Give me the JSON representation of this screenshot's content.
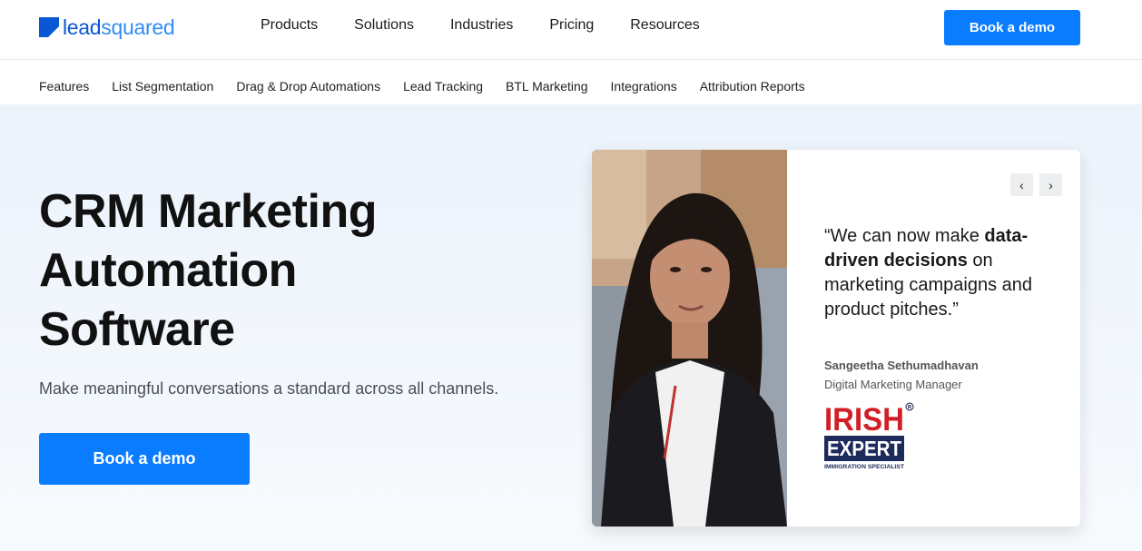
{
  "brand": {
    "logo_lead": "lead",
    "logo_squared": "squared",
    "colors": {
      "primary": "#0a7cff",
      "logo_dark": "#0a57d6",
      "logo_light": "#2f8cf5"
    }
  },
  "header": {
    "menu": [
      "Products",
      "Solutions",
      "Industries",
      "Pricing",
      "Resources"
    ],
    "cta": "Book a demo"
  },
  "subnav": {
    "items": [
      "Features",
      "List Segmentation",
      "Drag & Drop Automations",
      "Lead Tracking",
      "BTL Marketing",
      "Integrations",
      "Attribution Reports"
    ]
  },
  "hero": {
    "title_lines": [
      "CRM Marketing",
      "Automation",
      "Software"
    ],
    "subtitle": "Make meaningful conversations a standard across all channels.",
    "cta": "Book a demo"
  },
  "testimonial": {
    "quote_open": "“We can now make ",
    "quote_bold": "data-driven decisions",
    "quote_rest": " on marketing campaigns and product pitches.”",
    "name": "Sangeetha Sethumadhavan",
    "role": "Digital Marketing Manager",
    "company_logo": {
      "line1": "IRISH",
      "line2": "EXPERT",
      "tagline": "IMMIGRATION SPECIALIST",
      "registered": "R"
    },
    "prev_icon": "chevron-left-icon",
    "next_icon": "chevron-right-icon",
    "prev_glyph": "‹",
    "next_glyph": "›"
  }
}
